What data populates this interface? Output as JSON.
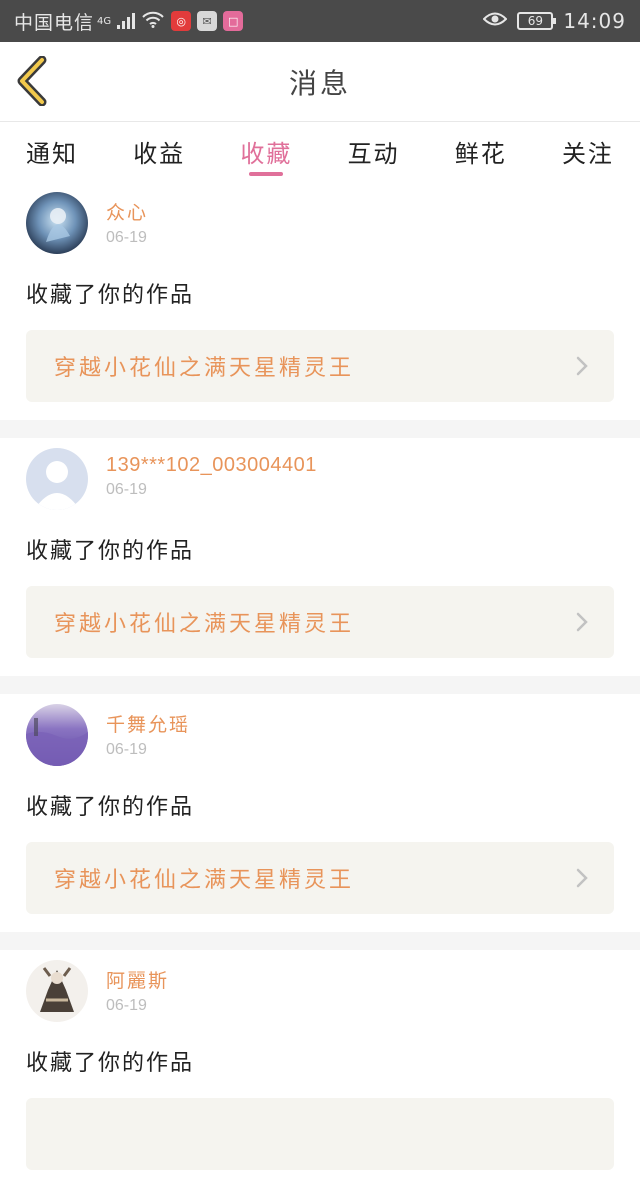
{
  "status_bar": {
    "carrier": "中国电信",
    "network": "4G",
    "battery": "69",
    "time": "14:09"
  },
  "header": {
    "title": "消息"
  },
  "tabs": [
    {
      "label": "通知",
      "active": false
    },
    {
      "label": "收益",
      "active": false
    },
    {
      "label": "收藏",
      "active": true
    },
    {
      "label": "互动",
      "active": false
    },
    {
      "label": "鲜花",
      "active": false
    },
    {
      "label": "关注",
      "active": false
    }
  ],
  "notifications": [
    {
      "username": "众心",
      "date": "06-19",
      "action": "收藏了你的作品",
      "work_title": "穿越小花仙之满天星精灵王"
    },
    {
      "username": "139***102_003004401",
      "date": "06-19",
      "action": "收藏了你的作品",
      "work_title": "穿越小花仙之满天星精灵王"
    },
    {
      "username": "千舞允瑶",
      "date": "06-19",
      "action": "收藏了你的作品",
      "work_title": "穿越小花仙之满天星精灵王"
    },
    {
      "username": "阿麗斯",
      "date": "06-19",
      "action": "收藏了你的作品",
      "work_title": ""
    }
  ],
  "colors": {
    "accent": "#e0709a",
    "username": "#e8945a",
    "status_bar": "#4a4a4a"
  }
}
